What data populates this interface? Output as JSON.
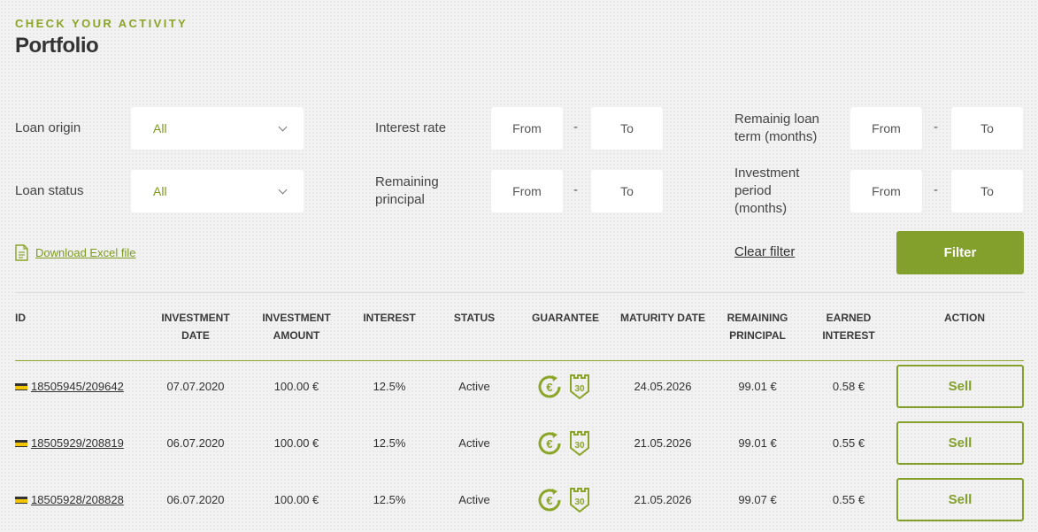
{
  "header": {
    "kicker": "CHECK YOUR ACTIVITY",
    "title": "Portfolio"
  },
  "filters": {
    "loan_origin": {
      "label": "Loan origin",
      "value": "All"
    },
    "loan_status": {
      "label": "Loan status",
      "value": "All"
    },
    "interest_rate": {
      "label": "Interest rate",
      "from": "From",
      "to": "To"
    },
    "remaining_principal": {
      "label": "Remaining principal",
      "from": "From",
      "to": "To"
    },
    "remaining_term": {
      "label": "Remainig loan term (months)",
      "from": "From",
      "to": "To"
    },
    "investment_period": {
      "label": "Investment period (months)",
      "from": "From",
      "to": "To"
    },
    "dash": "-"
  },
  "actions": {
    "download": "Download Excel file",
    "clear": "Clear filter",
    "filter": "Filter"
  },
  "table": {
    "headers": {
      "id": "ID",
      "investment_date": "INVESTMENT DATE",
      "investment_amount": "INVESTMENT AMOUNT",
      "interest": "INTEREST",
      "status": "STATUS",
      "guarantee": "GUARANTEE",
      "maturity_date": "MATURITY DATE",
      "remaining_principal": "REMAINING PRINCIPAL",
      "earned_interest": "EARNED INTEREST",
      "action": "ACTION"
    },
    "rows": [
      {
        "id": "18505945/209642",
        "investment_date": "07.07.2020",
        "amount": "100.00 €",
        "interest": "12.5%",
        "status": "Active",
        "guarantee_days": "30",
        "maturity": "24.05.2026",
        "principal": "99.01 €",
        "earned": "0.58 €",
        "action": "Sell"
      },
      {
        "id": "18505929/208819",
        "investment_date": "06.07.2020",
        "amount": "100.00 €",
        "interest": "12.5%",
        "status": "Active",
        "guarantee_days": "30",
        "maturity": "21.05.2026",
        "principal": "99.01 €",
        "earned": "0.55 €",
        "action": "Sell"
      },
      {
        "id": "18505928/208828",
        "investment_date": "06.07.2020",
        "amount": "100.00 €",
        "interest": "12.5%",
        "status": "Active",
        "guarantee_days": "30",
        "maturity": "21.05.2026",
        "principal": "99.07 €",
        "earned": "0.55 €",
        "action": "Sell"
      }
    ]
  },
  "colors": {
    "accent": "#84a02c",
    "accent_text": "#7d9a1e",
    "card_icon": "#f3c400"
  },
  "icons": {
    "document": "document-icon",
    "chevron": "chevron-down-icon",
    "buyback": "euro-buyback-icon",
    "shield": "shield-30-icon",
    "card": "card-icon"
  }
}
